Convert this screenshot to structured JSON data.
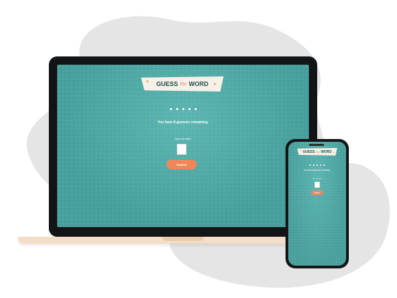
{
  "game": {
    "logo_left": "GUESS",
    "logo_middle": "the",
    "logo_right": "WORD",
    "word_slots": [
      "",
      "",
      "",
      "",
      ""
    ],
    "remaining_message": "You have 8 guesses remaining.",
    "input_label": "Type one letter:",
    "letter_value": "",
    "submit_label": "Guess!"
  },
  "colors": {
    "screen_teal": "#479f9b",
    "button_orange": "#f0865a",
    "logo_bg": "#f6f1e8",
    "logo_text": "#1f4b4d",
    "laptop_base": "#f4ddc6",
    "blob_gray": "#e5e5e5"
  }
}
